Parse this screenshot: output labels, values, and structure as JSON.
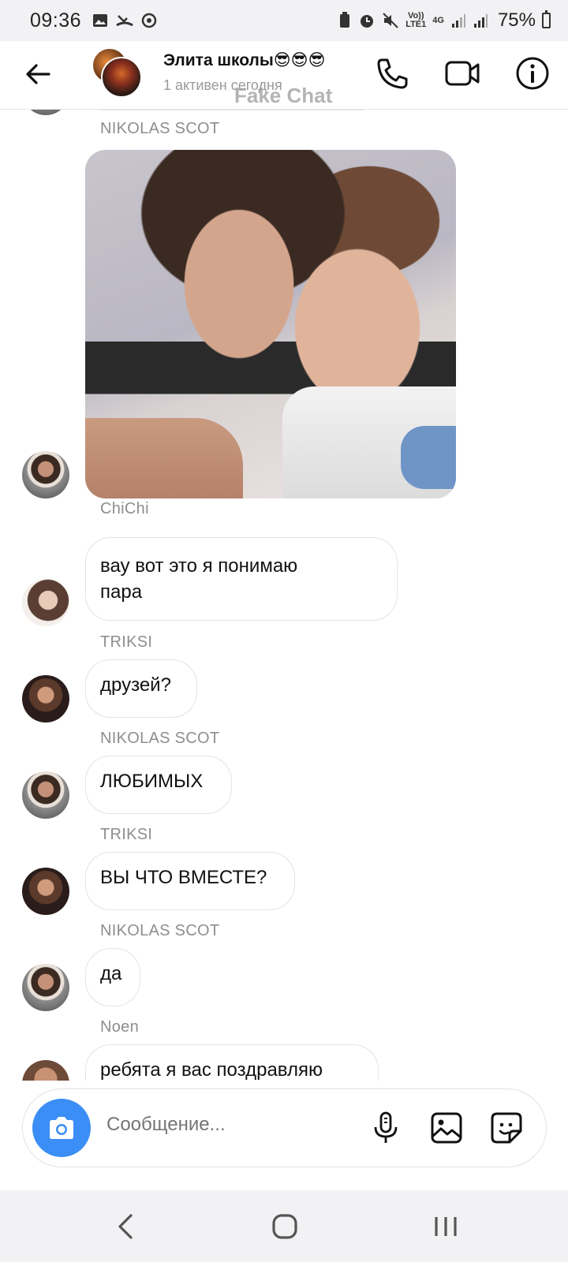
{
  "status_bar": {
    "time": "09:36",
    "network_top": "Vo))",
    "network_bottom": "LTE1",
    "network_type": "4G",
    "battery": "75%"
  },
  "header": {
    "title": "Элита школы",
    "title_emoji": "😎😎😎",
    "subtitle": "1 активен сегодня",
    "watermark": "Fake Chat"
  },
  "messages": [
    {
      "sender": "NIKOLAS SCOT",
      "type": "photo",
      "avatar": "nikolas"
    },
    {
      "sender": "ChiChi",
      "text_lines": [
        "вау вот это я понимаю",
        "пара"
      ],
      "avatar": "chichi"
    },
    {
      "sender": "TRIKSI",
      "text": "друзей?",
      "avatar": "triksi"
    },
    {
      "sender": "NIKOLAS SCOT",
      "text": "ЛЮБИМЫХ",
      "avatar": "nikolas"
    },
    {
      "sender": "TRIKSI",
      "text": "ВЫ ЧТО ВМЕСТЕ?",
      "avatar": "triksi"
    },
    {
      "sender": "NIKOLAS SCOT",
      "text": "да",
      "avatar": "nikolas"
    },
    {
      "sender": "Noen",
      "text": "ребята я вас поздравляю",
      "avatar": "noen"
    }
  ],
  "composer": {
    "placeholder": "Сообщение..."
  },
  "colors": {
    "accent_blue": "#3b8ef5",
    "bubble_border": "#e3e3e3",
    "sender_gray": "#8e8e8e"
  }
}
